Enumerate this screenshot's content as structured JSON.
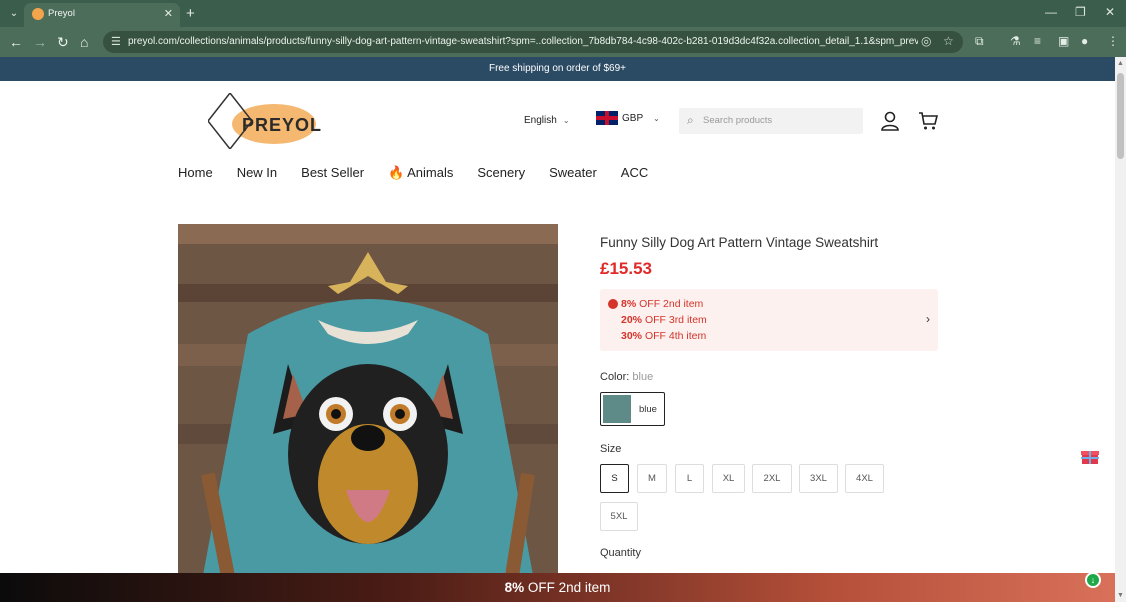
{
  "browser": {
    "tab_title": "Preyol",
    "url": "preyol.com/collections/animals/products/funny-silly-dog-art-pattern-vintage-sweatshirt?spm=..collection_7b8db784-4c98-402c-b281-019d3dc4f32a.collection_detail_1.1&spm_prev=..index.he..."
  },
  "announcement": "Free shipping on order of $69+",
  "header": {
    "logo_text": "PREYOL",
    "language": "English",
    "currency": "GBP",
    "search_placeholder": "Search products"
  },
  "nav": {
    "items": [
      "Home",
      "New In",
      "Best Seller",
      "Animals",
      "Scenery",
      "Sweater",
      "ACC"
    ]
  },
  "product": {
    "title": "Funny Silly Dog Art Pattern Vintage Sweatshirt",
    "price": "£15.53",
    "promos": [
      {
        "percent": "8%",
        "text": "OFF 2nd item"
      },
      {
        "percent": "20%",
        "text": "OFF 3rd item"
      },
      {
        "percent": "30%",
        "text": "OFF 4th item"
      }
    ],
    "color_label": "Color:",
    "color_value": "blue",
    "swatch_label": "blue",
    "size_label": "Size",
    "sizes": [
      "S",
      "M",
      "L",
      "XL",
      "2XL",
      "3XL",
      "4XL",
      "5XL"
    ],
    "selected_size": "S",
    "quantity_label": "Quantity"
  },
  "bottom_banner": {
    "percent": "8%",
    "text": "OFF 2nd item"
  },
  "colors": {
    "chrome": "#4b6d5a",
    "announcement_bg": "#2b4a64",
    "price": "#e02a2a",
    "promo_bg": "#fdf1ef"
  }
}
